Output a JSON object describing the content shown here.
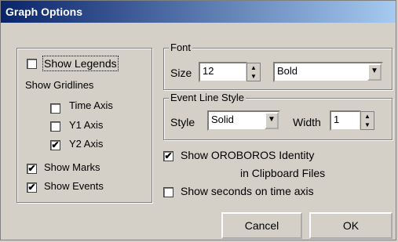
{
  "window": {
    "title": "Graph Options"
  },
  "left": {
    "show_legends": {
      "label": "Show Legends",
      "checked": false
    },
    "gridlines_heading": "Show Gridlines",
    "time_axis": {
      "label": "Time Axis",
      "checked": false
    },
    "y1_axis": {
      "label": "Y1 Axis",
      "checked": false
    },
    "y2_axis": {
      "label": "Y2 Axis",
      "checked": true
    },
    "show_marks": {
      "label": "Show Marks",
      "checked": true
    },
    "show_events": {
      "label": "Show Events",
      "checked": true
    }
  },
  "font": {
    "group_label": "Font",
    "size_label": "Size",
    "size_value": "12",
    "style_value": "Bold"
  },
  "event_line": {
    "group_label": "Event Line Style",
    "style_label": "Style",
    "style_value": "Solid",
    "width_label": "Width",
    "width_value": "1"
  },
  "options": {
    "identity_line1": "Show OROBOROS Identity",
    "identity_line2": "in Clipboard Files",
    "identity_checked": true,
    "seconds_label": "Show seconds on time axis",
    "seconds_checked": false
  },
  "buttons": {
    "cancel": "Cancel",
    "ok": "OK"
  },
  "glyphs": {
    "check": "✔",
    "up": "▲",
    "down": "▼"
  }
}
